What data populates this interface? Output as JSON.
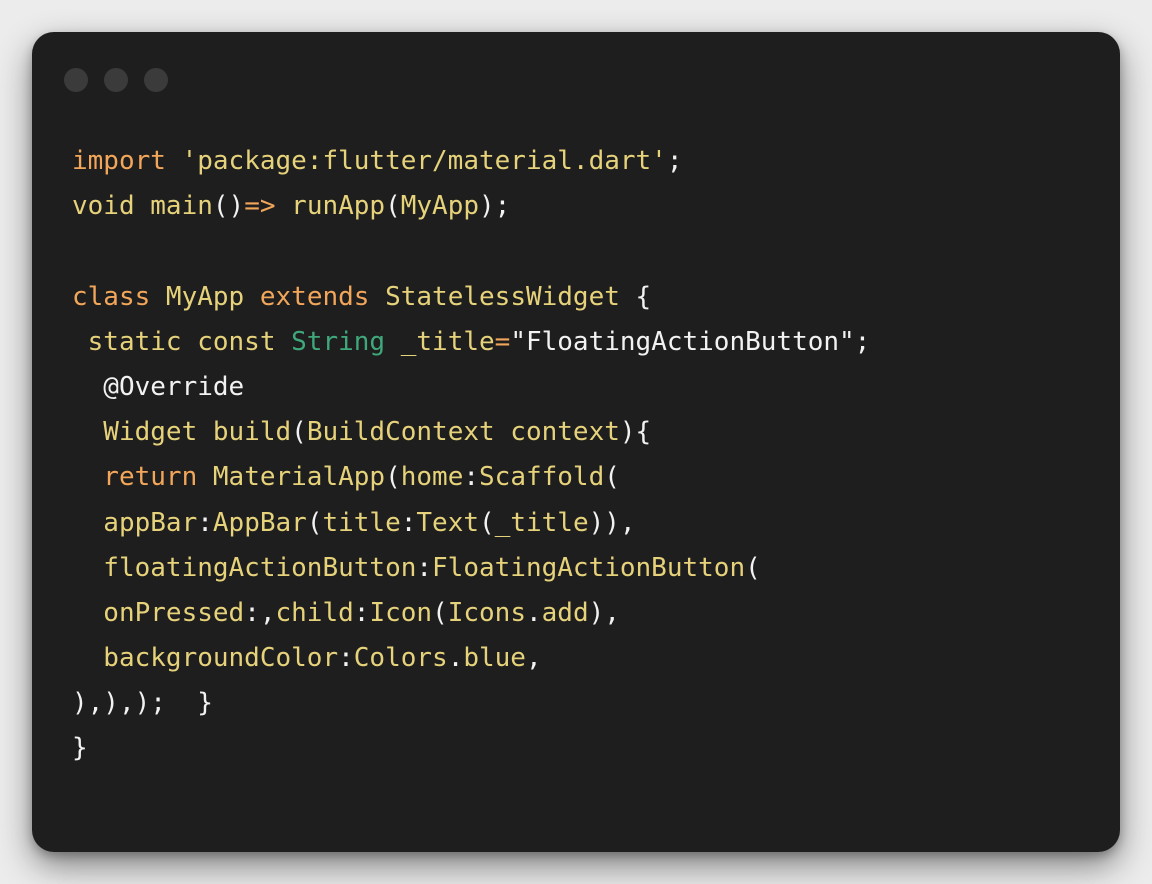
{
  "colors": {
    "background": "#ececec",
    "window": "#1e1e1e",
    "dot": "#3b3b3b",
    "keyword": "#f2a65a",
    "plain": "#e6d27a",
    "type": "#3fa87a",
    "punct": "#f2f2f2"
  },
  "window": {
    "controls": [
      "close-dot-icon",
      "minimize-dot-icon",
      "maximize-dot-icon"
    ]
  },
  "code": {
    "language": "dart",
    "lines": [
      [
        {
          "t": "keyword",
          "v": "import"
        },
        {
          "t": "punct",
          "v": " "
        },
        {
          "t": "string",
          "v": "'package:flutter/material.dart'"
        },
        {
          "t": "punct",
          "v": ";"
        }
      ],
      [
        {
          "t": "plain",
          "v": "void main"
        },
        {
          "t": "punct",
          "v": "()"
        },
        {
          "t": "keyword",
          "v": "=>"
        },
        {
          "t": "plain",
          "v": " runApp"
        },
        {
          "t": "punct",
          "v": "("
        },
        {
          "t": "plain",
          "v": "MyApp"
        },
        {
          "t": "punct",
          "v": ");"
        }
      ],
      [],
      [
        {
          "t": "keyword",
          "v": "class"
        },
        {
          "t": "plain",
          "v": " MyApp "
        },
        {
          "t": "keyword",
          "v": "extends"
        },
        {
          "t": "plain",
          "v": " StatelessWidget "
        },
        {
          "t": "punct",
          "v": "{"
        }
      ],
      [
        {
          "t": "plain",
          "v": " static const "
        },
        {
          "t": "type",
          "v": "String"
        },
        {
          "t": "plain",
          "v": " _title"
        },
        {
          "t": "keyword",
          "v": "="
        },
        {
          "t": "punct",
          "v": "\"FloatingActionButton\";"
        }
      ],
      [
        {
          "t": "anno",
          "v": "  @Override"
        }
      ],
      [
        {
          "t": "plain",
          "v": "  Widget build"
        },
        {
          "t": "punct",
          "v": "("
        },
        {
          "t": "plain",
          "v": "BuildContext context"
        },
        {
          "t": "punct",
          "v": "){"
        }
      ],
      [
        {
          "t": "keyword",
          "v": "  return"
        },
        {
          "t": "plain",
          "v": " MaterialApp"
        },
        {
          "t": "punct",
          "v": "("
        },
        {
          "t": "plain",
          "v": "home"
        },
        {
          "t": "punct",
          "v": ":"
        },
        {
          "t": "plain",
          "v": "Scaffold"
        },
        {
          "t": "punct",
          "v": "("
        }
      ],
      [
        {
          "t": "plain",
          "v": "  appBar"
        },
        {
          "t": "punct",
          "v": ":"
        },
        {
          "t": "plain",
          "v": "AppBar"
        },
        {
          "t": "punct",
          "v": "("
        },
        {
          "t": "plain",
          "v": "title"
        },
        {
          "t": "punct",
          "v": ":"
        },
        {
          "t": "plain",
          "v": "Text"
        },
        {
          "t": "punct",
          "v": "("
        },
        {
          "t": "plain",
          "v": "_title"
        },
        {
          "t": "punct",
          "v": ")),"
        }
      ],
      [
        {
          "t": "plain",
          "v": "  floatingActionButton"
        },
        {
          "t": "punct",
          "v": ":"
        },
        {
          "t": "plain",
          "v": "FloatingActionButton"
        },
        {
          "t": "punct",
          "v": "("
        }
      ],
      [
        {
          "t": "plain",
          "v": "  onPressed"
        },
        {
          "t": "punct",
          "v": ":,"
        },
        {
          "t": "plain",
          "v": "child"
        },
        {
          "t": "punct",
          "v": ":"
        },
        {
          "t": "plain",
          "v": "Icon"
        },
        {
          "t": "punct",
          "v": "("
        },
        {
          "t": "plain",
          "v": "Icons"
        },
        {
          "t": "punct",
          "v": "."
        },
        {
          "t": "plain",
          "v": "add"
        },
        {
          "t": "punct",
          "v": "),"
        }
      ],
      [
        {
          "t": "plain",
          "v": "  backgroundColor"
        },
        {
          "t": "punct",
          "v": ":"
        },
        {
          "t": "plain",
          "v": "Colors"
        },
        {
          "t": "punct",
          "v": "."
        },
        {
          "t": "plain",
          "v": "blue"
        },
        {
          "t": "punct",
          "v": ","
        }
      ],
      [
        {
          "t": "punct",
          "v": "),),);  }"
        }
      ],
      [
        {
          "t": "punct",
          "v": "}"
        }
      ]
    ]
  }
}
